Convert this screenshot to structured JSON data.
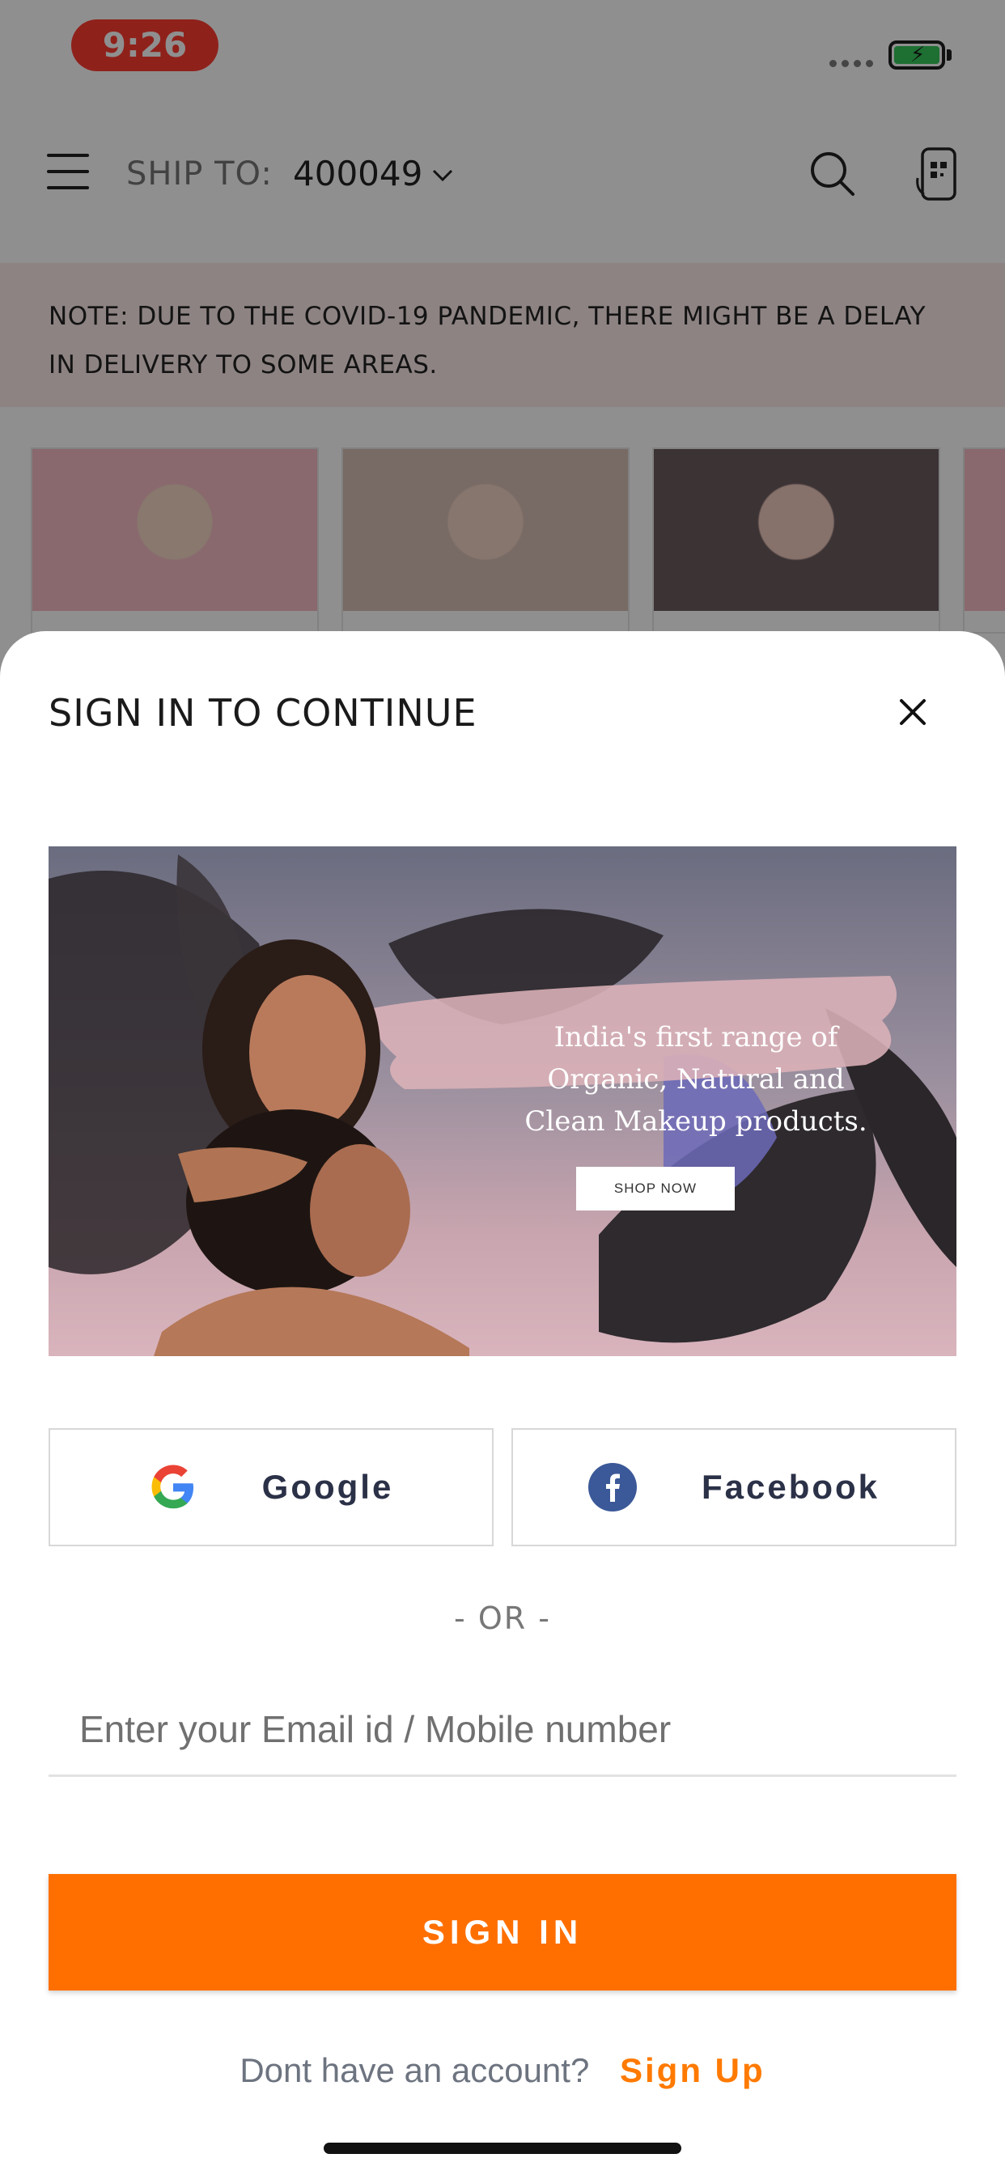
{
  "status_bar": {
    "time": "9:26"
  },
  "header": {
    "ship_to_label": "SHIP TO:",
    "pincode": "400049"
  },
  "notice": {
    "text": "NOTE: DUE TO THE COVID-19 PANDEMIC, THERE MIGHT BE A DELAY IN DELIVERY TO SOME AREAS."
  },
  "signin_sheet": {
    "title": "SIGN IN TO CONTINUE",
    "banner": {
      "lines": [
        "India's first range of",
        "Organic, Natural and",
        "Clean Makeup products."
      ],
      "cta": "SHOP NOW"
    },
    "google_label": "Google",
    "facebook_label": "Facebook",
    "or_text": "- OR -",
    "email_placeholder": "Enter your Email id / Mobile number",
    "signin_button": "SIGN IN",
    "no_account_text": "Dont have an account?",
    "signup_link": "Sign Up"
  },
  "colors": {
    "accent": "#ff6f00",
    "time_pill": "#ff3b30",
    "notice_bg": "#fdeaea"
  }
}
